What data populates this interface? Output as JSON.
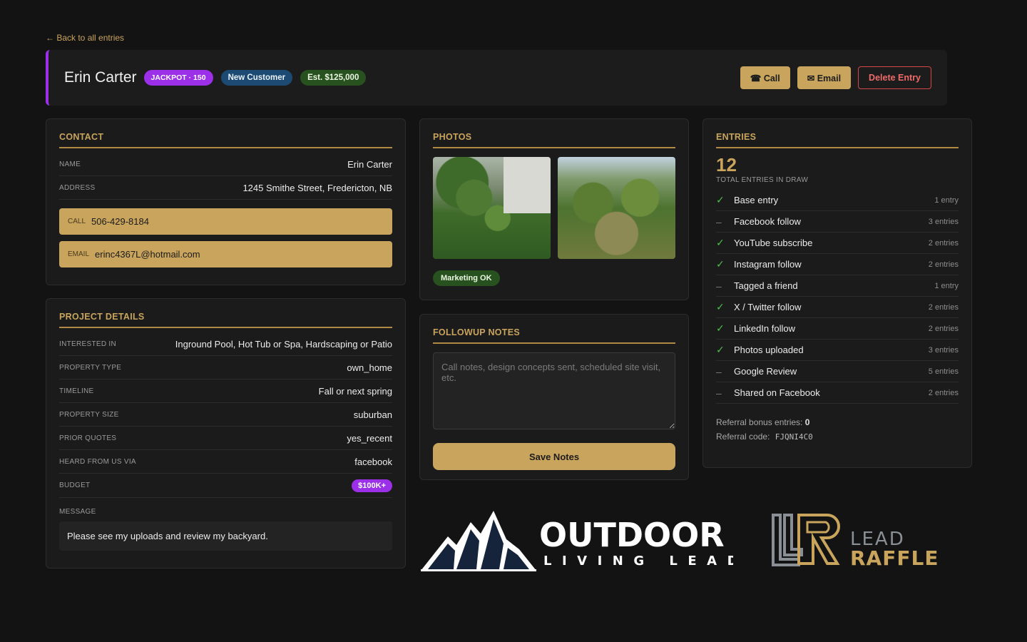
{
  "nav": {
    "back_label": "← Back to all entries"
  },
  "header": {
    "name": "Erin Carter",
    "badges": {
      "jackpot": "JACKPOT · 150",
      "customer": "New Customer",
      "estimate": "Est. $125,000"
    },
    "actions": {
      "call": "☎ Call",
      "email": "✉ Email",
      "delete": "Delete Entry"
    }
  },
  "contact": {
    "title": "CONTACT",
    "name_label": "NAME",
    "name_value": "Erin Carter",
    "address_label": "ADDRESS",
    "address_value": "1245 Smithe Street, Fredericton, NB",
    "call_label": "CALL",
    "phone": "506-429-8184",
    "email_label": "EMAIL",
    "email": "erinc4367L@hotmail.com"
  },
  "project": {
    "title": "PROJECT DETAILS",
    "rows": [
      {
        "label": "INTERESTED IN",
        "value": "Inground Pool, Hot Tub or Spa, Hardscaping or Patio"
      },
      {
        "label": "PROPERTY TYPE",
        "value": "own_home"
      },
      {
        "label": "TIMELINE",
        "value": "Fall or next spring"
      },
      {
        "label": "PROPERTY SIZE",
        "value": "suburban"
      },
      {
        "label": "PRIOR QUOTES",
        "value": "yes_recent"
      },
      {
        "label": "HEARD FROM US VIA",
        "value": "facebook"
      }
    ],
    "budget_label": "BUDGET",
    "budget_value": "$100K+",
    "message_label": "MESSAGE",
    "message": "Please see my uploads and review my backyard."
  },
  "photos": {
    "title": "PHOTOS",
    "marketing": "Marketing OK"
  },
  "notes": {
    "title": "FOLLOWUP NOTES",
    "placeholder": "Call notes, design concepts sent, scheduled site visit, etc.",
    "save_label": "Save Notes"
  },
  "entries": {
    "title": "ENTRIES",
    "total": "12",
    "total_label": "TOTAL ENTRIES IN DRAW",
    "items": [
      {
        "label": "Base entry",
        "count": "1 entry",
        "done": true
      },
      {
        "label": "Facebook follow",
        "count": "3 entries",
        "done": false
      },
      {
        "label": "YouTube subscribe",
        "count": "2 entries",
        "done": true
      },
      {
        "label": "Instagram follow",
        "count": "2 entries",
        "done": true
      },
      {
        "label": "Tagged a friend",
        "count": "1 entry",
        "done": false
      },
      {
        "label": "X / Twitter follow",
        "count": "2 entries",
        "done": true
      },
      {
        "label": "LinkedIn follow",
        "count": "2 entries",
        "done": true
      },
      {
        "label": "Photos uploaded",
        "count": "3 entries",
        "done": true
      },
      {
        "label": "Google Review",
        "count": "5 entries",
        "done": false
      },
      {
        "label": "Shared on Facebook",
        "count": "2 entries",
        "done": false
      }
    ],
    "referral_bonus_label": "Referral bonus entries:",
    "referral_bonus_value": "0",
    "referral_code_label": "Referral code:",
    "referral_code": "FJQNI4C0"
  },
  "logos": {
    "outdoor_top": "OUTDOOR",
    "outdoor_bottom": "LIVING LEADS",
    "raffle_top": "LEAD",
    "raffle_bottom": "RAFFLE"
  },
  "colors": {
    "accent": "#c9a45c",
    "purple": "#9b30e8",
    "green_pill": "#27511f",
    "blue_pill": "#1d4a73",
    "danger": "#d24848"
  }
}
